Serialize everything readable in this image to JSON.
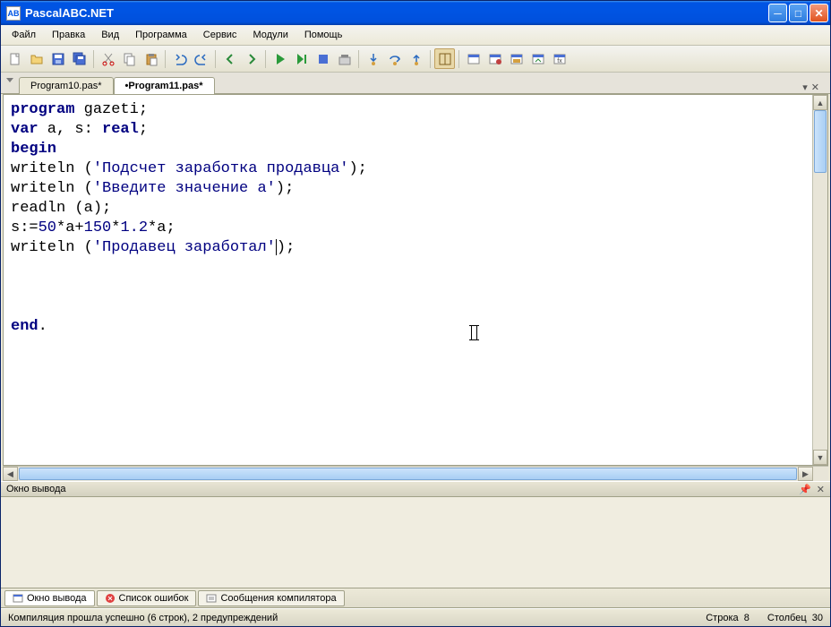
{
  "window": {
    "title": "PascalABC.NET"
  },
  "menu": {
    "items": [
      "Файл",
      "Правка",
      "Вид",
      "Программа",
      "Сервис",
      "Модули",
      "Помощь"
    ]
  },
  "tabs": {
    "items": [
      {
        "label": "Program10.pas*",
        "active": false
      },
      {
        "label": "•Program11.pas*",
        "active": true
      }
    ],
    "dropdown": "▾",
    "close": "✕"
  },
  "code": {
    "l1a": "program",
    "l1b": " gazeti;",
    "l2a": "var",
    "l2b": " a, s: ",
    "l2c": "real",
    "l2d": ";",
    "l3": "begin",
    "l4a": "writeln (",
    "l4b": "'Подсчет заработка продавца'",
    "l4c": ");",
    "l5a": "writeln (",
    "l5b": "'Введите значение a'",
    "l5c": ");",
    "l6": "readln (a);",
    "l7a": "s:=",
    "l7b": "50",
    "l7c": "*a+",
    "l7d": "150",
    "l7e": "*",
    "l7f": "1.2",
    "l7g": "*a;",
    "l8a": "writeln (",
    "l8b": "'Продавец заработал'",
    "l8c": ");",
    "l9": "end",
    "l9b": "."
  },
  "output": {
    "title": "Окно вывода",
    "pin": "📌",
    "close": "✕"
  },
  "bottomTabs": {
    "items": [
      {
        "label": "Окно вывода",
        "active": true
      },
      {
        "label": "Список ошибок",
        "active": false
      },
      {
        "label": "Сообщения компилятора",
        "active": false
      }
    ]
  },
  "status": {
    "left": "Компиляция прошла успешно (6 строк), 2 предупреждений",
    "line_label": "Строка",
    "line_val": "8",
    "col_label": "Столбец",
    "col_val": "30"
  }
}
